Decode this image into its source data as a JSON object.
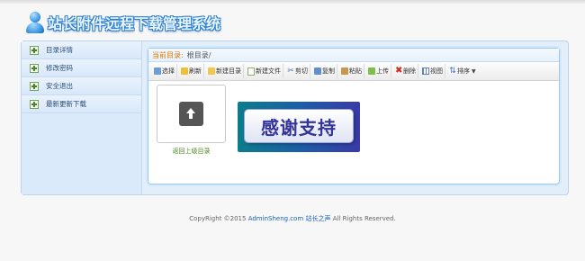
{
  "header": {
    "title": "站长附件远程下载管理系统",
    "logo_icon": "user-icon"
  },
  "sidebar": {
    "items": [
      {
        "label": "目录详情",
        "icon": "plus-icon"
      },
      {
        "label": "修改密码",
        "icon": "plus-icon"
      },
      {
        "label": "安全退出",
        "icon": "plus-icon"
      },
      {
        "label": "最新更新下载",
        "icon": "plus-icon"
      }
    ]
  },
  "main": {
    "path_label": "当前目录:",
    "path_value": "根目录/",
    "toolbar": [
      {
        "label": "选择",
        "icon": "select-icon"
      },
      {
        "label": "刷新",
        "icon": "refresh-icon"
      },
      {
        "label": "新建目录",
        "icon": "new-folder-icon"
      },
      {
        "label": "新建文件",
        "icon": "new-file-icon"
      },
      {
        "label": "剪切",
        "icon": "cut-icon"
      },
      {
        "label": "复制",
        "icon": "copy-icon"
      },
      {
        "label": "粘贴",
        "icon": "paste-icon"
      },
      {
        "label": "上传",
        "icon": "upload-icon"
      },
      {
        "label": "删除",
        "icon": "delete-icon"
      },
      {
        "label": "视图",
        "icon": "view-icon"
      },
      {
        "label": "排序",
        "icon": "sort-icon"
      }
    ],
    "up_item_label": "返回上级目录",
    "banner_text": "感谢支持"
  },
  "footer": {
    "prefix": "CopyRight ©2015",
    "site": "AdminSheng.com",
    "site_name": "站长之声",
    "suffix": "All Rights Reserved."
  },
  "colors": {
    "path_label": "#e07a00",
    "up_label": "#4a8a1f",
    "footer_link": "#1a62b8",
    "banner_text": "#33339a"
  }
}
